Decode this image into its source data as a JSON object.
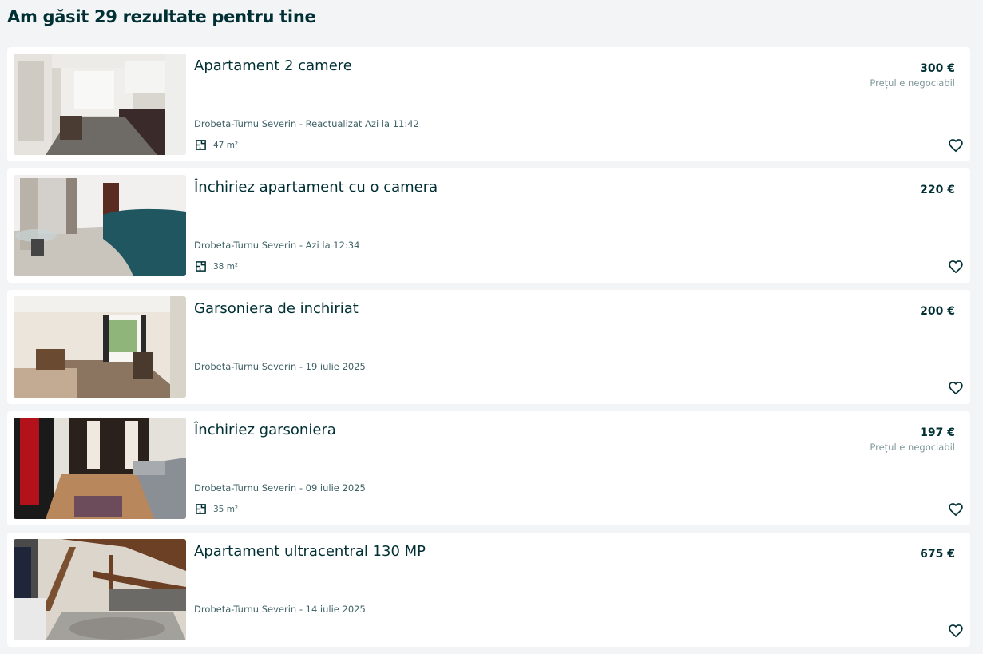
{
  "header": {
    "results_title": "Am găsit 29 rezultate pentru tine"
  },
  "icons": {
    "favorite": "heart-outline-icon",
    "area": "floor-plan-icon"
  },
  "colors": {
    "text": "#002f34",
    "muted": "#406367",
    "background": "#f2f4f5",
    "card": "#ffffff"
  },
  "listings": [
    {
      "title": "Apartament 2 camere",
      "price": "300 €",
      "negotiable": "Prețul e negociabil",
      "location_date": "Drobeta-Turnu Severin - Reactualizat Azi la 11:42",
      "area": "47 m²"
    },
    {
      "title": "Închiriez apartament cu o camera",
      "price": "220 €",
      "location_date": "Drobeta-Turnu Severin - Azi la 12:34",
      "area": "38 m²"
    },
    {
      "title": "Garsoniera de inchiriat",
      "price": "200 €",
      "location_date": "Drobeta-Turnu Severin - 19 iulie 2025"
    },
    {
      "title": "Închiriez garsoniera",
      "price": "197 €",
      "negotiable": "Prețul e negociabil",
      "location_date": "Drobeta-Turnu Severin - 09 iulie 2025",
      "area": "35 m²"
    },
    {
      "title": "Apartament ultracentral 130 MP",
      "price": "675 €",
      "location_date": "Drobeta-Turnu Severin - 14 iulie 2025"
    }
  ]
}
